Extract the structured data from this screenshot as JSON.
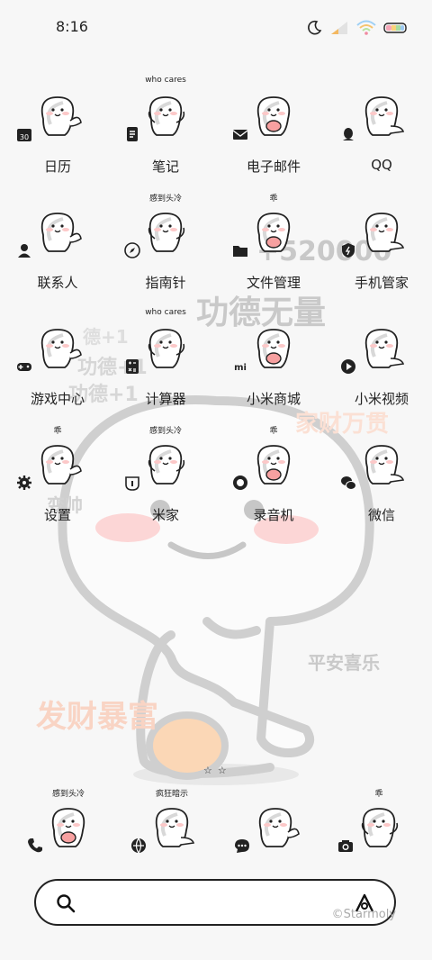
{
  "status_bar": {
    "time": "8:16",
    "icons": [
      "moon-icon",
      "signal-icon",
      "wifi-icon",
      "battery-icon"
    ]
  },
  "wallpaper": {
    "texts": [
      {
        "text": "+520000",
        "color": "#c8c8c8"
      },
      {
        "text": "功德无量",
        "color": "#c9c9c9"
      },
      {
        "text": "德+1",
        "color": "#dedede"
      },
      {
        "text": "功德+1",
        "color": "#d6d6d6"
      },
      {
        "text": "功德+1",
        "color": "#d6d6d6"
      },
      {
        "text": "家财万贯",
        "color": "#fbe0d4"
      },
      {
        "text": "变帅",
        "color": "#d2d2d2"
      },
      {
        "text": "平安喜乐",
        "color": "#c9c9c9"
      },
      {
        "text": "发财暴富",
        "color": "#f9d4c4"
      }
    ]
  },
  "apps": [
    {
      "label": "日历",
      "badge": "calendar-icon",
      "sticker_text": ""
    },
    {
      "label": "笔记",
      "badge": "notes-icon",
      "sticker_text": "who cares"
    },
    {
      "label": "电子邮件",
      "badge": "mail-icon",
      "sticker_text": ""
    },
    {
      "label": "QQ",
      "badge": "qq-icon",
      "sticker_text": ""
    },
    {
      "label": "联系人",
      "badge": "contacts-icon",
      "sticker_text": ""
    },
    {
      "label": "指南针",
      "badge": "compass-icon",
      "sticker_text": "感到头冷"
    },
    {
      "label": "文件管理",
      "badge": "folder-icon",
      "sticker_text": "乖"
    },
    {
      "label": "手机管家",
      "badge": "shield-icon",
      "sticker_text": ""
    },
    {
      "label": "游戏中心",
      "badge": "gamepad-icon",
      "sticker_text": ""
    },
    {
      "label": "计算器",
      "badge": "calculator-icon",
      "sticker_text": "who cares"
    },
    {
      "label": "小米商城",
      "badge": "mi-icon",
      "sticker_text": ""
    },
    {
      "label": "小米视频",
      "badge": "play-icon",
      "sticker_text": ""
    },
    {
      "label": "设置",
      "badge": "gear-icon",
      "sticker_text": "乖"
    },
    {
      "label": "米家",
      "badge": "mijia-icon",
      "sticker_text": "感到头冷"
    },
    {
      "label": "录音机",
      "badge": "record-icon",
      "sticker_text": "乖"
    },
    {
      "label": "微信",
      "badge": "wechat-icon",
      "sticker_text": ""
    }
  ],
  "dock": [
    {
      "badge": "phone-icon",
      "sticker_text": "感到头冷"
    },
    {
      "badge": "browser-icon",
      "sticker_text": "疯狂暗示"
    },
    {
      "badge": "messages-icon",
      "sticker_text": ""
    },
    {
      "badge": "camera-icon",
      "sticker_text": "乖"
    }
  ],
  "search_bar": {
    "search_icon": "search-icon",
    "assistant_icon": "assistant-icon"
  },
  "watermark": "©Starmoly"
}
